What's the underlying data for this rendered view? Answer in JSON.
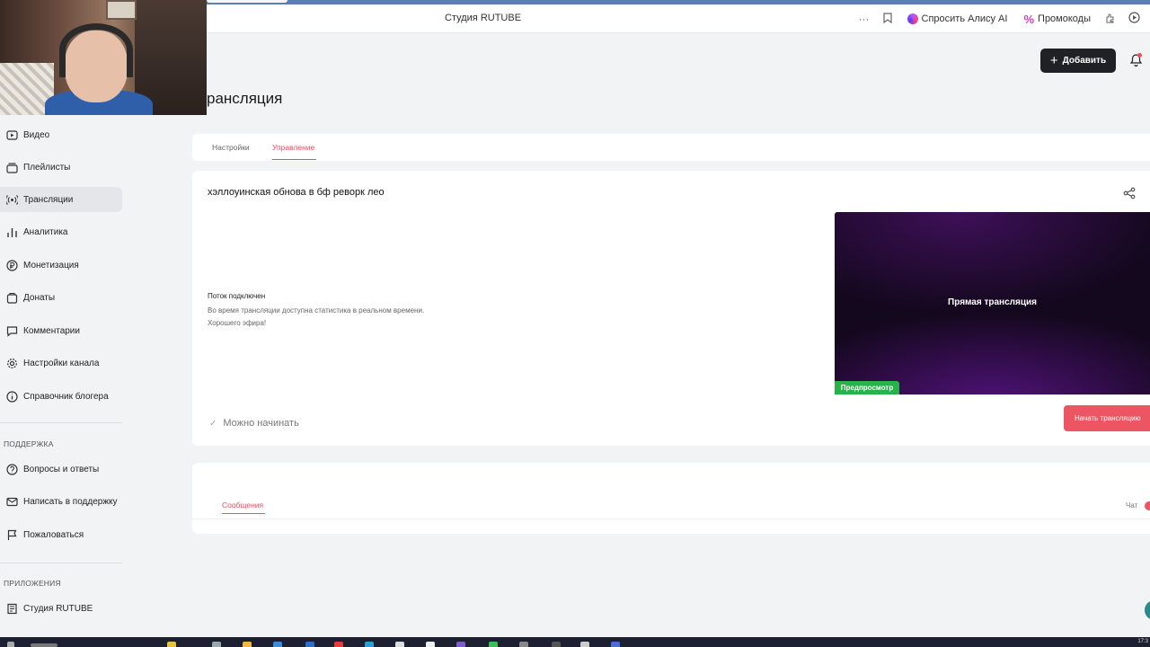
{
  "browser": {
    "title": "Студия RUTUBE",
    "more": "···",
    "alice": "Спросить Алису AI",
    "promo": "Промокоды"
  },
  "header": {
    "page_title": "рансляция",
    "add_button": "Добавить"
  },
  "sidebar": {
    "items": [
      {
        "label": "Видео",
        "icon": "video-icon"
      },
      {
        "label": "Плейлисты",
        "icon": "playlist-icon"
      },
      {
        "label": "Трансляции",
        "icon": "broadcast-icon",
        "active": true
      },
      {
        "label": "Аналитика",
        "icon": "analytics-icon"
      },
      {
        "label": "Монетизация",
        "icon": "ruble-icon"
      },
      {
        "label": "Донаты",
        "icon": "donate-icon"
      },
      {
        "label": "Комментарии",
        "icon": "comment-icon"
      },
      {
        "label": "Настройки канала",
        "icon": "gear-icon"
      },
      {
        "label": "Справочник блогера",
        "icon": "info-icon"
      }
    ],
    "support_label": "ПОДДЕРЖКА",
    "support_items": [
      {
        "label": "Вопросы и ответы",
        "icon": "question-icon"
      },
      {
        "label": "Написать в поддержку",
        "icon": "mail-icon"
      },
      {
        "label": "Пожаловаться",
        "icon": "flag-icon"
      }
    ],
    "apps_label": "ПРИЛОЖЕНИЯ",
    "apps_items": [
      {
        "label": "Студия RUTUBE",
        "icon": "studio-icon"
      }
    ]
  },
  "tabs": {
    "settings": "Настройки",
    "control": "Управление"
  },
  "stream": {
    "title": "хэллоуинская обнова в бф реворк лео",
    "status_title": "Поток подключен",
    "status_line1": "Во время трансляции доступна статистика в реальном времени.",
    "status_line2": "Хорошего эфира!",
    "ready": "Можно начинать",
    "preview_label": "Прямая трансляция",
    "preview_badge": "Предпросмотр",
    "start_button": "Начать трансляцию"
  },
  "chat": {
    "messages_tab": "Сообщения",
    "chat_label": "Чат"
  },
  "taskbar": {
    "clock": "17:3"
  }
}
